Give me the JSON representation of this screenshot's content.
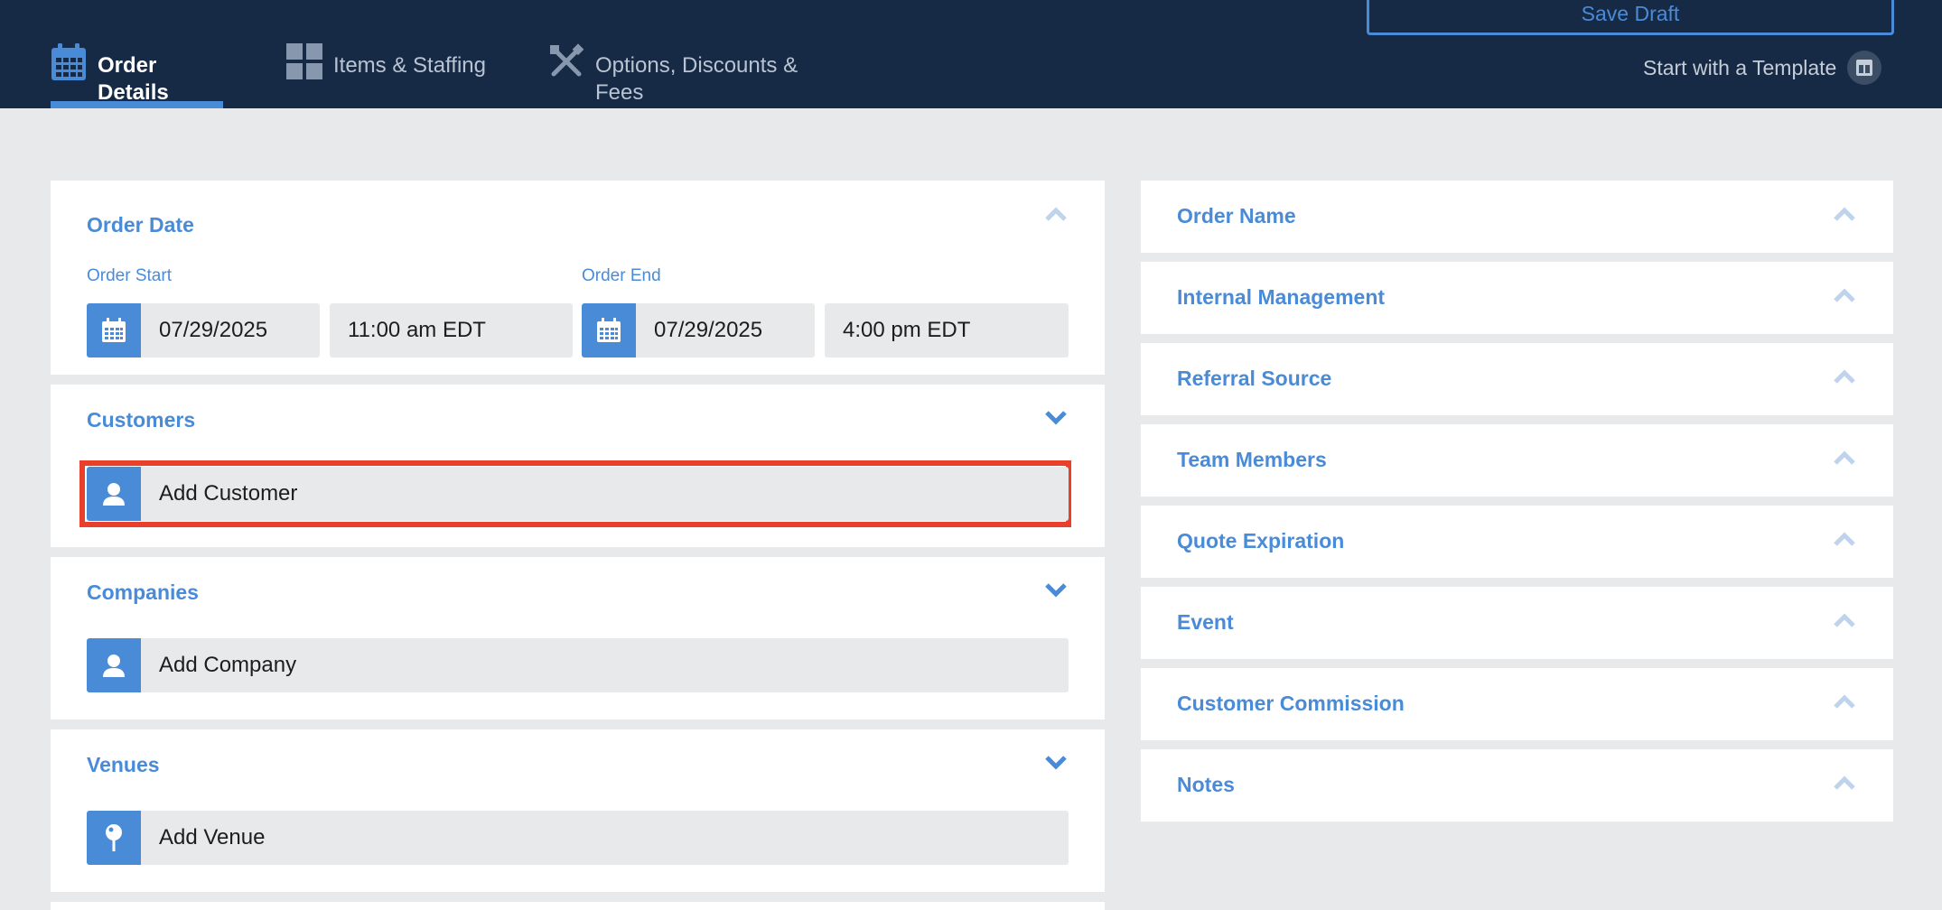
{
  "header": {
    "save_draft": "Save Draft",
    "tabs": [
      {
        "label": "Order Details",
        "icon": "calendar-icon",
        "active": true
      },
      {
        "label": "Items & Staffing",
        "icon": "grid-icon",
        "active": false
      },
      {
        "label": "Options, Discounts & Fees",
        "icon": "tools-icon",
        "active": false
      }
    ],
    "template_link": "Start with a Template"
  },
  "order_date": {
    "title": "Order Date",
    "start_label": "Order Start",
    "end_label": "Order End",
    "start_date": "07/29/2025",
    "start_time": "11:00 am EDT",
    "end_date": "07/29/2025",
    "end_time": "4:00 pm EDT"
  },
  "customers": {
    "title": "Customers",
    "add_label": "Add Customer"
  },
  "companies": {
    "title": "Companies",
    "add_label": "Add Company"
  },
  "venues": {
    "title": "Venues",
    "add_label": "Add Venue"
  },
  "right_sections": [
    {
      "title": "Order Name"
    },
    {
      "title": "Internal Management"
    },
    {
      "title": "Referral Source"
    },
    {
      "title": "Team Members"
    },
    {
      "title": "Quote Expiration"
    },
    {
      "title": "Event"
    },
    {
      "title": "Customer Commission"
    },
    {
      "title": "Notes"
    }
  ],
  "colors": {
    "header_bg": "#172a45",
    "accent": "#4a8bd8",
    "highlight": "#e8402a",
    "page_bg": "#e8e9eb"
  }
}
